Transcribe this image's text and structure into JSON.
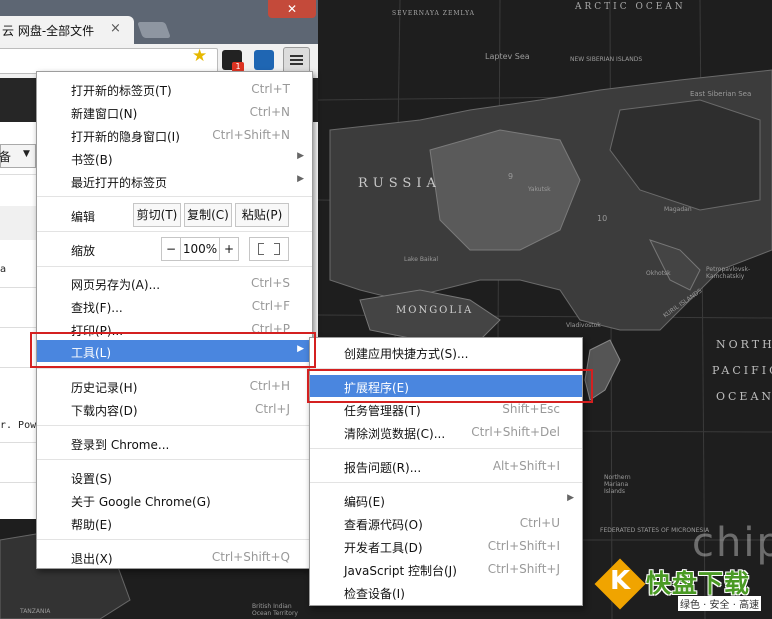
{
  "window": {
    "tab_title": "云 网盘-全部文件",
    "tab_close": "×",
    "close_button": "✕"
  },
  "toolbar": {
    "star_icon": "star-icon",
    "ext_badge": "1",
    "menu_icon": "hamburger-menu-icon"
  },
  "page": {
    "dropdown_label": "备",
    "row_text_1": "a",
    "row_text_2": "r. Power"
  },
  "menu": {
    "items": [
      {
        "label": "打开新的标签页(T)",
        "shortcut": "Ctrl+T"
      },
      {
        "label": "新建窗口(N)",
        "shortcut": "Ctrl+N"
      },
      {
        "label": "打开新的隐身窗口(I)",
        "shortcut": "Ctrl+Shift+N"
      },
      {
        "label": "书签(B)",
        "shortcut": ""
      },
      {
        "label": "最近打开的标签页",
        "shortcut": ""
      },
      {
        "label": "编辑",
        "shortcut": ""
      },
      {
        "label": "缩放",
        "shortcut": ""
      },
      {
        "label": "网页另存为(A)...",
        "shortcut": "Ctrl+S"
      },
      {
        "label": "查找(F)...",
        "shortcut": "Ctrl+F"
      },
      {
        "label": "打印(P)...",
        "shortcut": "Ctrl+P"
      },
      {
        "label": "工具(L)",
        "shortcut": ""
      },
      {
        "label": "历史记录(H)",
        "shortcut": "Ctrl+H"
      },
      {
        "label": "下载内容(D)",
        "shortcut": "Ctrl+J"
      },
      {
        "label": "登录到 Chrome...",
        "shortcut": ""
      },
      {
        "label": "设置(S)",
        "shortcut": ""
      },
      {
        "label": "关于 Google Chrome(G)",
        "shortcut": ""
      },
      {
        "label": "帮助(E)",
        "shortcut": ""
      },
      {
        "label": "退出(X)",
        "shortcut": "Ctrl+Shift+Q"
      }
    ],
    "edit": {
      "cut": "剪切(T)",
      "copy": "复制(C)",
      "paste": "粘贴(P)"
    },
    "zoom": {
      "minus": "−",
      "value": "100%",
      "plus": "+"
    },
    "arrow": "▶"
  },
  "submenu": {
    "items": [
      {
        "label": "创建应用快捷方式(S)...",
        "shortcut": ""
      },
      {
        "label": "扩展程序(E)",
        "shortcut": ""
      },
      {
        "label": "任务管理器(T)",
        "shortcut": "Shift+Esc"
      },
      {
        "label": "清除浏览数据(C)...",
        "shortcut": "Ctrl+Shift+Del"
      },
      {
        "label": "报告问题(R)...",
        "shortcut": "Alt+Shift+I"
      },
      {
        "label": "编码(E)",
        "shortcut": ""
      },
      {
        "label": "查看源代码(O)",
        "shortcut": "Ctrl+U"
      },
      {
        "label": "开发者工具(D)",
        "shortcut": "Ctrl+Shift+I"
      },
      {
        "label": "JavaScript 控制台(J)",
        "shortcut": "Ctrl+Shift+J"
      },
      {
        "label": "检查设备(I)",
        "shortcut": ""
      }
    ]
  },
  "map": {
    "russia": "RUSSIA",
    "mongolia": "MONGOLIA",
    "arctic_ocean": "ARCTIC OCEAN",
    "north_pacific_ocean": [
      "NORTH",
      "PACIFIC",
      "OCEAN"
    ],
    "laptev_sea": "Laptev Sea",
    "new_siberian_islands": "NEW SIBERIAN ISLANDS",
    "east_siberian_sea": "East Siberian Sea",
    "severnaya_zemlya": "SEVERNAYA ZEMLYA",
    "yakutsk": "Yakutsk",
    "magadan": "Magadan",
    "lake_baikal": "Lake Baikal",
    "okhotsk": "Okhotsk",
    "petropavlovsk": "Petropavlovsk-Kamchatskiy",
    "vladivostok": "Vladivostok",
    "kuril_islands": "KURIL ISLANDS",
    "northern_mariana": "Northern Mariana Islands",
    "micronesia": "FEDERATED STATES OF MICRONESIA",
    "tanzania": "TANZANIA",
    "indian_ocean_territory": "British Indian Ocean Territory",
    "time_zone_10": "10",
    "time_zone_9": "9"
  },
  "watermark": {
    "logo_letter": "K",
    "title": "快盘下载",
    "subtitle": "绿色 · 安全 · 高速",
    "chip": "chip"
  }
}
